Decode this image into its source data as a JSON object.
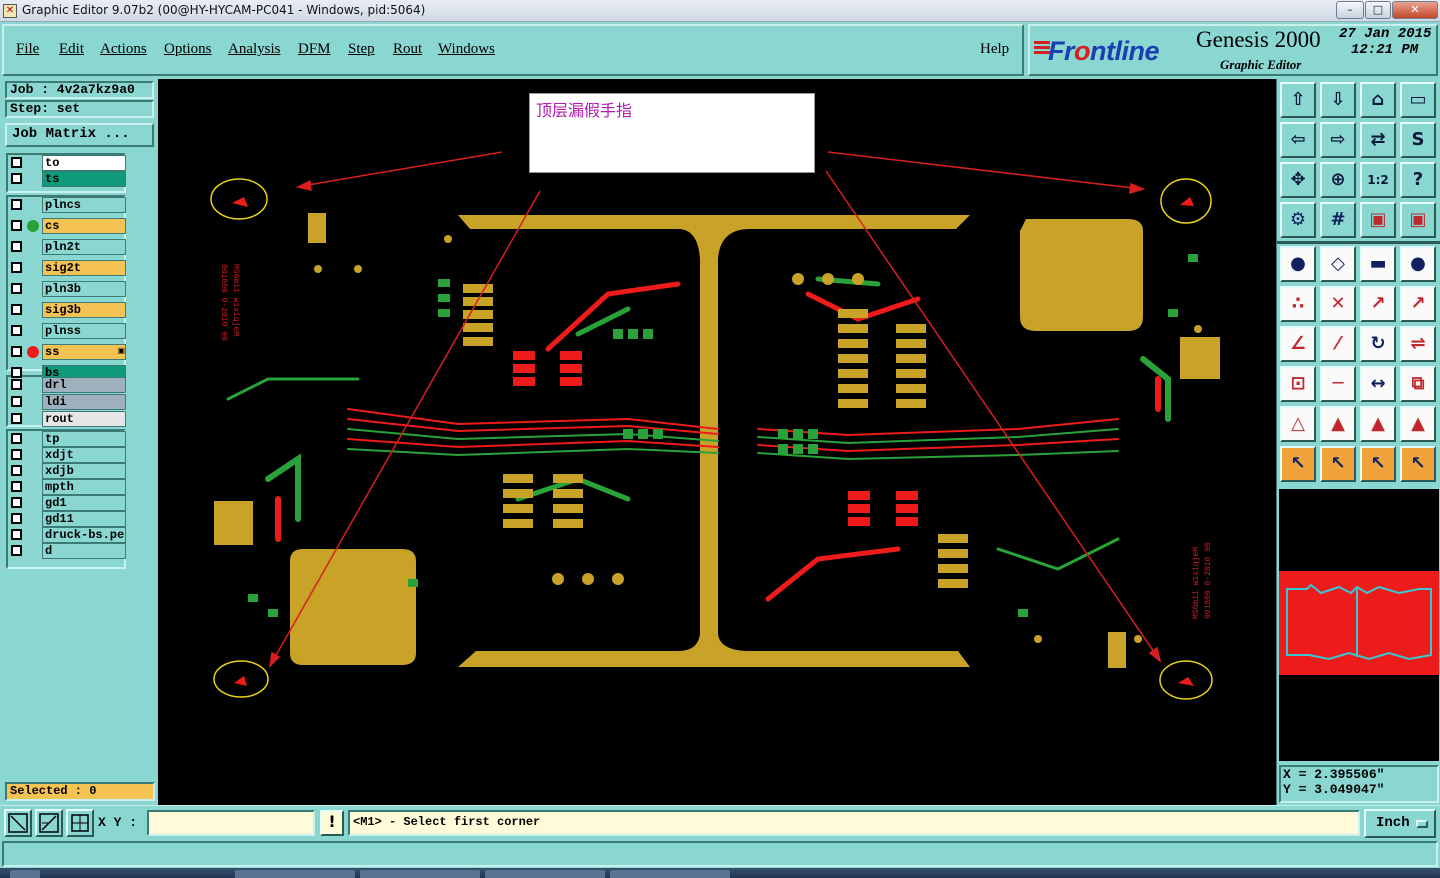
{
  "window": {
    "title": "Graphic Editor 9.07b2 (00@HY-HYCAM-PC041 - Windows, pid:5064)",
    "minimize": "–",
    "maximize": "□",
    "close": "✕"
  },
  "menu": {
    "items": [
      "File",
      "Edit",
      "Actions",
      "Options",
      "Analysis",
      "DFM",
      "Step",
      "Rout",
      "Windows"
    ],
    "help": "Help"
  },
  "brand": {
    "logo_prefix": "Fr",
    "logo_o": "o",
    "logo_suffix": "ntline",
    "product": "Genesis 2000",
    "subtitle": "Graphic Editor",
    "date": "27 Jan 2015",
    "time": "12:21 PM"
  },
  "left_panel": {
    "job": "Job : 4v2a7kz9a0",
    "step": "Step: set",
    "job_matrix_button": "Job Matrix ...",
    "selected": "Selected : 0",
    "layers": [
      {
        "name": "to",
        "color": "#ffffff",
        "dot": ""
      },
      {
        "name": "ts",
        "color": "#0f9a7a",
        "dot": ""
      },
      {
        "name": "plncs",
        "color": "#8ad6d0",
        "dot": ""
      },
      {
        "name": "cs",
        "color": "#f5c353",
        "dot": "#2aa23a"
      },
      {
        "name": "pln2t",
        "color": "#8ad6d0",
        "dot": ""
      },
      {
        "name": "sig2t",
        "color": "#f5c353",
        "dot": ""
      },
      {
        "name": "pln3b",
        "color": "#8ad6d0",
        "dot": ""
      },
      {
        "name": "sig3b",
        "color": "#f5c353",
        "dot": ""
      },
      {
        "name": "plnss",
        "color": "#8ad6d0",
        "dot": ""
      },
      {
        "name": "ss",
        "color": "#f5c353",
        "dot": "#ee1b1b",
        "flag": "▣"
      },
      {
        "name": "bs",
        "color": "#0f9a7a",
        "dot": ""
      },
      {
        "name": "drl",
        "color": "#9fb0bc",
        "dot": ""
      },
      {
        "name": "ldi",
        "color": "#9fb0bc",
        "dot": ""
      },
      {
        "name": "rout",
        "color": "#e6e6e6",
        "dot": ""
      },
      {
        "name": "tp",
        "color": "#8ad6d0",
        "dot": ""
      },
      {
        "name": "xdjt",
        "color": "#8ad6d0",
        "dot": ""
      },
      {
        "name": "xdjb",
        "color": "#8ad6d0",
        "dot": ""
      },
      {
        "name": "mpth",
        "color": "#8ad6d0",
        "dot": ""
      },
      {
        "name": "gd1",
        "color": "#8ad6d0",
        "dot": ""
      },
      {
        "name": "gd11",
        "color": "#8ad6d0",
        "dot": ""
      },
      {
        "name": "druck-bs.per",
        "color": "#8ad6d0",
        "dot": ""
      },
      {
        "name": "d",
        "color": "#8ad6d0",
        "dot": ""
      }
    ]
  },
  "canvas": {
    "annotation": "顶层漏假手指",
    "colors": {
      "background": "#000000",
      "copper": "#c9a327",
      "top_trace": "#2aa23a",
      "bottom_trace": "#ee1b1b",
      "arrow": "#d61f1f",
      "marker": "#e8d21a",
      "text": "#d61f1f"
    }
  },
  "toolbar": {
    "icons": [
      "zoom-home-icon",
      "zoom-page-icon",
      "home-view-icon",
      "split-window-icon",
      "pan-left-icon",
      "pan-right-icon",
      "swap-icon",
      "snap-icon",
      "fit-all-icon",
      "zoom-box-icon",
      "scale-1-2-icon",
      "help-query-icon",
      "measure-icon",
      "grid-icon",
      "layer-colors-icon",
      "layer-settings-icon",
      "fill-mode-icon",
      "outline-mode-icon",
      "ruler-icon",
      "pad-icon",
      "net-icon",
      "cross-icon",
      "line-to-point-icon",
      "line-to-dot-icon",
      "angle-icon",
      "diagonal-icon",
      "arc-icon",
      "mirror-icon",
      "move-icon",
      "split-line-icon",
      "size-icon",
      "copy-icon",
      "triangle-snap-icon",
      "triangle-add-icon",
      "triangle-edit-icon",
      "triangle-select-icon",
      "select-arrow-icon",
      "select-box-icon",
      "select-rotate-icon",
      "select-path-icon"
    ],
    "coords_x": "X = 2.395506\"",
    "coords_y": "Y = 3.049047\""
  },
  "bottom": {
    "xy_label": "X Y :",
    "xy_value": "",
    "warn": "!",
    "message": "<M1> - Select first corner",
    "unit": "Inch"
  }
}
